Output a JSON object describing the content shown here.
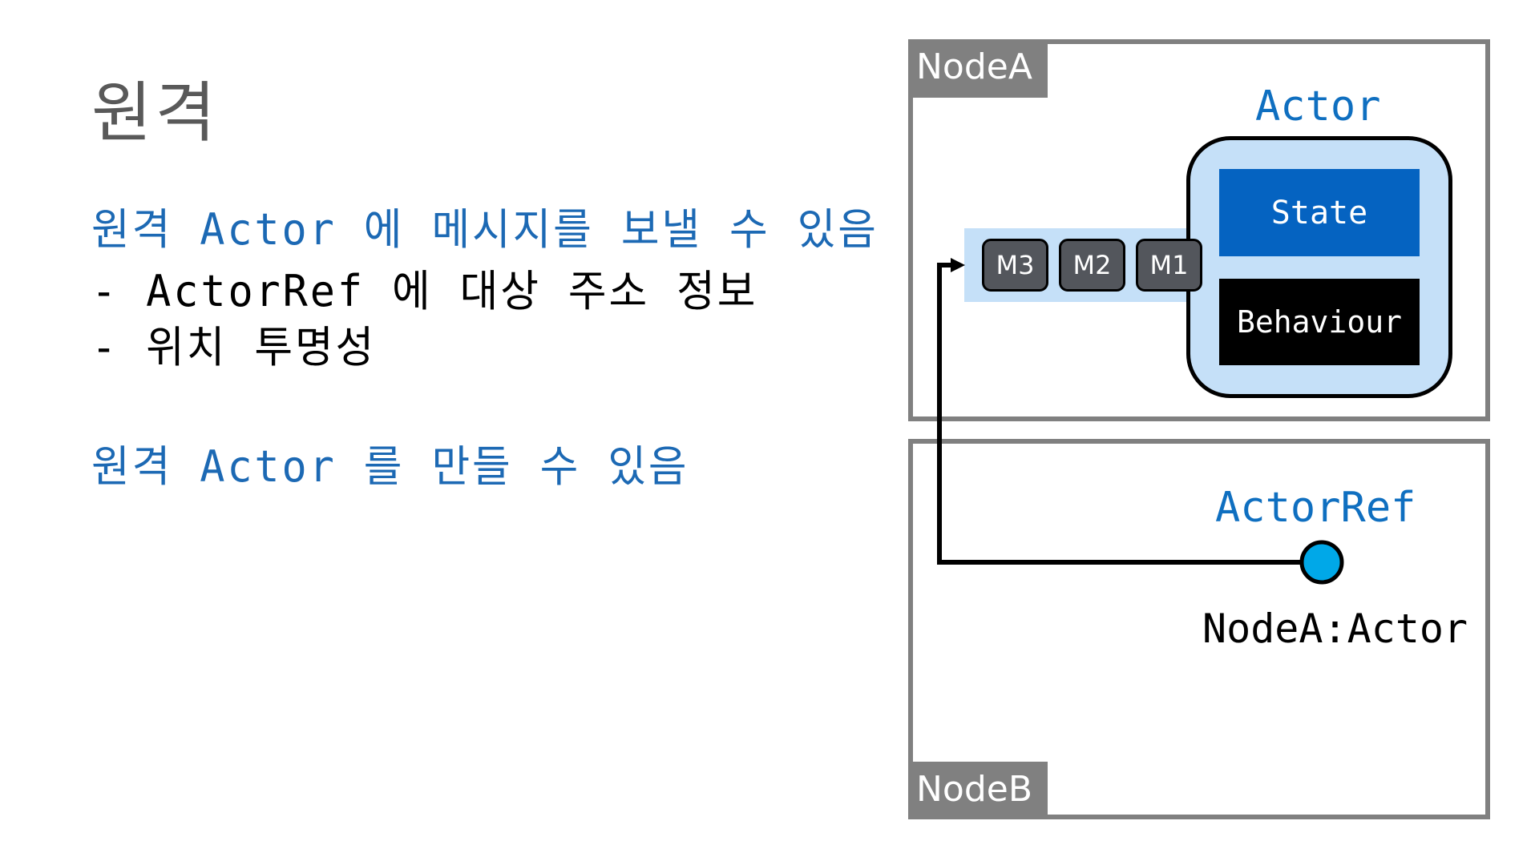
{
  "slide": {
    "title": "원격",
    "bullets": [
      {
        "text": "원격 Actor 에 메시지를 보낼 수 있음",
        "color": "#1c69b4"
      },
      {
        "text": "- ActorRef 에 대상 주소 정보",
        "color": "#000000"
      },
      {
        "text": "- 위치 투명성",
        "color": "#000000"
      },
      {
        "text": "원격 Actor 를 만들 수 있음",
        "color": "#1c69b4"
      }
    ]
  },
  "diagram": {
    "node_a": {
      "label": "NodeA",
      "actor": {
        "title": "Actor",
        "state_label": "State",
        "behaviour_label": "Behaviour",
        "mailbox": [
          "M3",
          "M2",
          "M1"
        ]
      }
    },
    "node_b": {
      "label": "NodeB",
      "actor_ref": {
        "title": "ActorRef",
        "address": "NodeA:Actor"
      }
    },
    "colors": {
      "node_border": "#808080",
      "actor_fill": "#c5e0f8",
      "state_fill": "#0563c1",
      "behaviour_fill": "#000000",
      "message_fill": "#53565c",
      "ref_dot": "#00a8e8",
      "label_blue": "#0f6fc0"
    }
  }
}
